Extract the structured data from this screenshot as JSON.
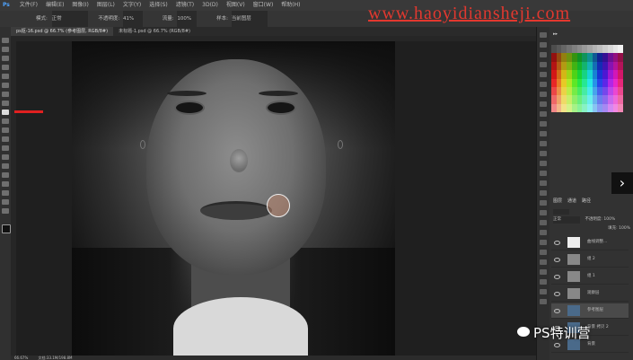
{
  "app": {
    "logo": "Ps"
  },
  "menu": [
    "文件(F)",
    "编辑(E)",
    "图像(I)",
    "图层(L)",
    "文字(Y)",
    "选择(S)",
    "滤镜(T)",
    "3D(D)",
    "视图(V)",
    "窗口(W)",
    "帮助(H)"
  ],
  "options": {
    "mode_label": "模式:",
    "mode_value": "正常",
    "opacity_label": "不透明度:",
    "opacity_value": "41%",
    "flow_label": "流量:",
    "flow_value": "100%",
    "sample_label": "样本:",
    "sample_value": "当前图层"
  },
  "tabs": [
    {
      "label": "ps抠-16.psd @ 66.7% (参考图层, RGB/8#)",
      "active": true
    },
    {
      "label": "未标题-1.psd @ 66.7% (RGB/8#)",
      "active": false
    }
  ],
  "watermark": "www.haoyidiansheji.com",
  "status": {
    "zoom": "66.67%",
    "doc": "文档:33.1M/198.8M"
  },
  "layers_panel": {
    "tabs": [
      "图层",
      "通道",
      "路径"
    ],
    "blend_mode": "正常",
    "opacity_label": "不透明度:",
    "opacity_value": "100%",
    "fill_label": "填充:",
    "fill_value": "100%",
    "layers": [
      {
        "name": "曲线调整...",
        "selected": false
      },
      {
        "name": "组 2",
        "selected": false
      },
      {
        "name": "组 1",
        "selected": false
      },
      {
        "name": "观察层",
        "selected": false
      },
      {
        "name": "参考图层",
        "selected": true
      },
      {
        "name": "背景 拷贝 2",
        "selected": false
      },
      {
        "name": "背景",
        "selected": false
      }
    ]
  },
  "brand": "PS特训营",
  "nav_arrow": "›",
  "colors": {
    "accent": "#e3382f",
    "panel_bg": "#323232",
    "selected_row": "#4a4a4a"
  }
}
